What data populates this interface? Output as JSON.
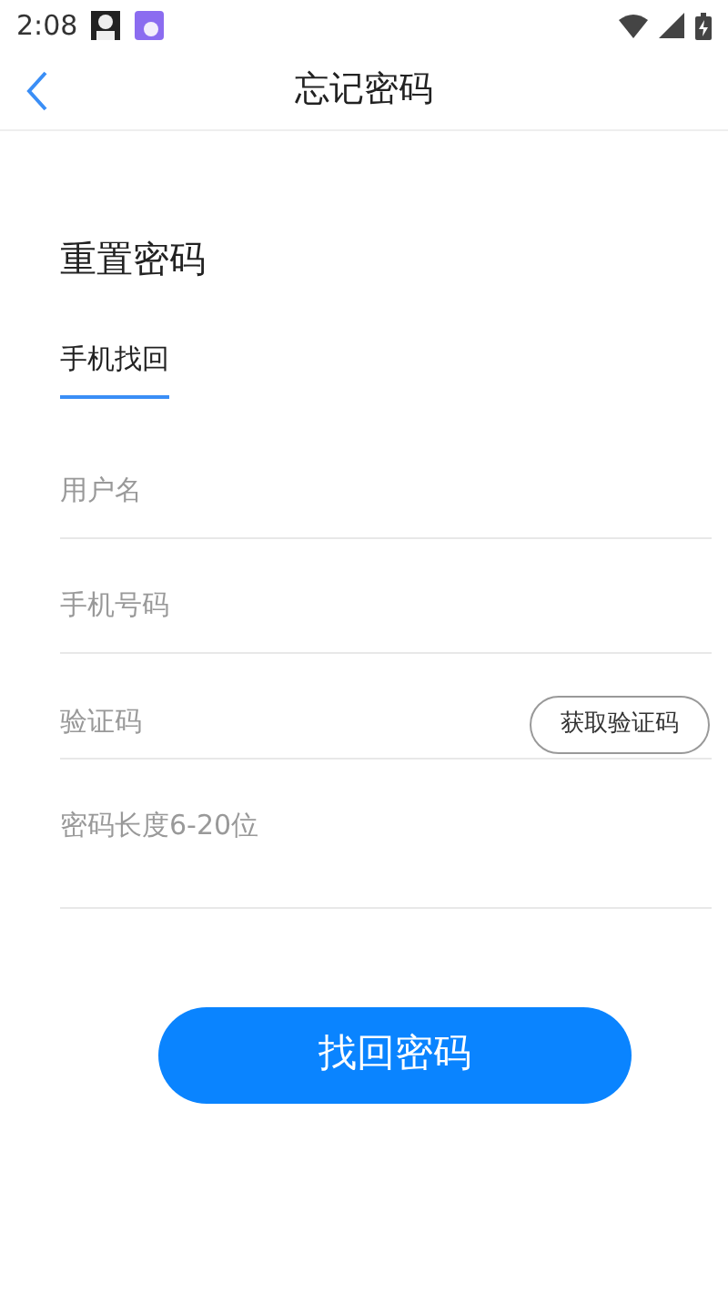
{
  "status_bar": {
    "time": "2:08"
  },
  "header": {
    "title": "忘记密码"
  },
  "heading": "重置密码",
  "tabs": [
    {
      "label": "手机找回",
      "selected": true
    }
  ],
  "fields": [
    {
      "kind": "text",
      "placeholder": "用户名"
    },
    {
      "kind": "text",
      "placeholder": "手机号码"
    },
    {
      "kind": "code",
      "placeholder": "验证码",
      "button": "获取验证码"
    },
    {
      "kind": "password",
      "placeholder": "密码长度6-20位"
    }
  ],
  "submit": "找回密码"
}
